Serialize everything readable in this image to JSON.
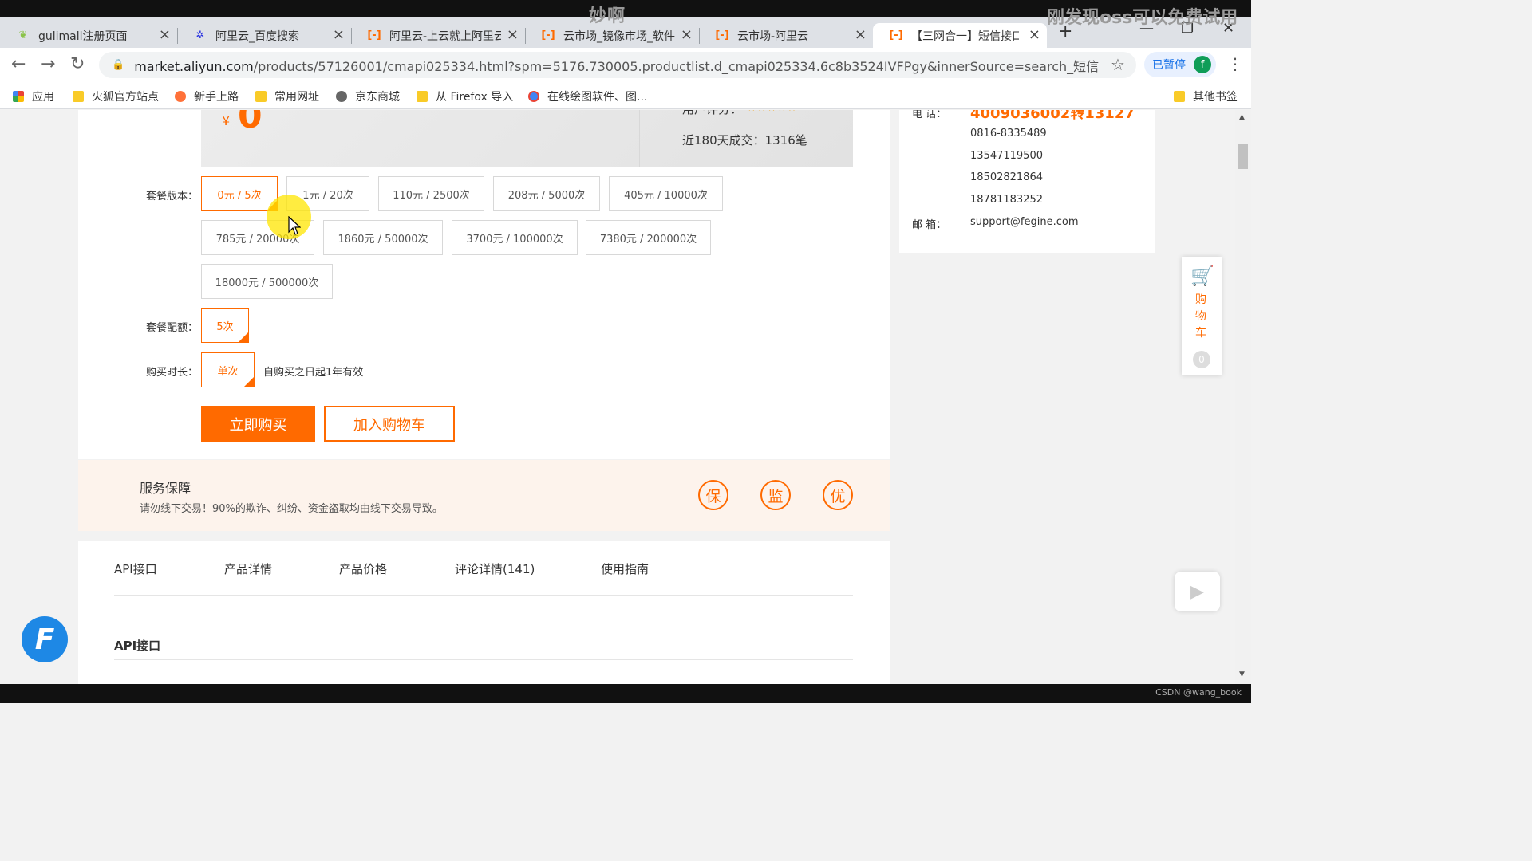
{
  "overlay": {
    "center_text": "妙啊",
    "right_text": "刚发现oss可以免费试用"
  },
  "tabs": [
    {
      "label": "gulimall注册页面",
      "icon": "leaf-icon"
    },
    {
      "label": "阿里云_百度搜索",
      "icon": "paw-icon"
    },
    {
      "label": "阿里云-上云就上阿里云",
      "icon": "aliyun-icon"
    },
    {
      "label": "云市场_镜像市场_软件商",
      "icon": "aliyun-icon"
    },
    {
      "label": "云市场-阿里云",
      "icon": "aliyun-icon"
    },
    {
      "label": "【三网合一】短信接口",
      "icon": "aliyun-icon",
      "active": true
    }
  ],
  "address": {
    "host": "market.aliyun.com",
    "path": "/products/57126001/cmapi025334.html?spm=5176.730005.productlist.d_cmapi025334.6c8b3524IVFPgy&innerSource=search_短信#sku=..."
  },
  "profile": {
    "paused_label": "已暂停",
    "initial": "f"
  },
  "bookmarks": [
    "应用",
    "火狐官方站点",
    "新手上路",
    "常用网址",
    "京东商城",
    "从 Firefox 导入",
    "在线绘图软件、图...",
    "其他书签"
  ],
  "product": {
    "currency": "¥",
    "price": "0",
    "rating_label": "用户评分：",
    "stars": "★★★★★",
    "sales": "近180天成交：1316笔"
  },
  "package": {
    "version_label": "套餐版本：",
    "versions": [
      "0元 / 5次",
      "1元 / 20次",
      "110元 / 2500次",
      "208元 / 5000次",
      "405元 / 10000次",
      "785元 / 20000次",
      "1860元 / 50000次",
      "3700元 / 100000次",
      "7380元 / 200000次",
      "18000元 / 500000次"
    ],
    "quota_label": "套餐配额：",
    "quota": "5次",
    "duration_label": "购买时长：",
    "duration": "单次",
    "validity": "自购买之日起1年有效"
  },
  "actions": {
    "buy_now": "立即购买",
    "add_to_cart": "加入购物车"
  },
  "service": {
    "title": "服务保障",
    "desc": "请勿线下交易！90%的欺诈、纠纷、资金盗取均由线下交易导致。",
    "badges": [
      "保",
      "监",
      "优"
    ]
  },
  "detail_tabs": [
    "API接口",
    "产品详情",
    "产品价格",
    "评论详情(141)",
    "使用指南"
  ],
  "section_title": "API接口",
  "contact": {
    "tel_label": "电 话：",
    "tel_main": "4009036002转13127",
    "phones": [
      "0816-8335489",
      "13547119500",
      "18502821864",
      "18781183252"
    ],
    "email_label": "邮 箱：",
    "email": "support@fegine.com"
  },
  "side_cart": {
    "label": "购物车",
    "count": "0"
  },
  "watermark": "CSDN @wang_book",
  "colors": {
    "accent": "#ff6a00",
    "service_bg": "#fdf3ec"
  }
}
